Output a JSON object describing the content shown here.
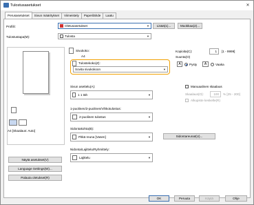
{
  "window": {
    "title": "Tulostusasetukset",
    "close_glyph": "✕"
  },
  "tabs": [
    "Perusasetukset",
    "Sivun määritykset",
    "Viimeistely",
    "Paperilähde",
    "Laatu"
  ],
  "profile": {
    "label": "Profiili:",
    "value": "Oletusasetukset",
    "add": "Lisää(1)...",
    "edit": "Muokkaa(2)..."
  },
  "output": {
    "label": "Tulostustapa(M):",
    "value": "Tulosta"
  },
  "page_size": {
    "label": "Sivukoko:",
    "value": "A4"
  },
  "output_size": {
    "label": "Tulostekoko(Z):",
    "value": "Sovita sivukokoon"
  },
  "copies": {
    "label": "Kopioita(C):",
    "value": "1",
    "range": "[1 - 9999]"
  },
  "orientation": {
    "label": "Suunta(O)",
    "portrait": "Pysty",
    "landscape": "Vaaka"
  },
  "layout": {
    "label": "Sivun asettelu(A):",
    "value": "1 1 täh"
  },
  "manual_scale": {
    "label": "Manuaalinen skaalaus",
    "scale_label": "Skaalaus(O):",
    "scale_value": "100",
    "scale_range": "% [25 - 200]",
    "center": "Alkupiste keskelle(R)"
  },
  "duplex": {
    "label": "1-puolinen/2-puolinen/Vihkotulostus:",
    "value": "2-puolinen tulostus"
  },
  "binding": {
    "label": "Sidontakohta(B):",
    "value": "Pitkä reuna [Vasen]",
    "margin_btn": "Sidontareunat(U)..."
  },
  "collate": {
    "label": "Nidonta/Lajittelu/Ryhmittely:",
    "value": "Lajittelu"
  },
  "preview": {
    "caption": "A4 [Skaalaus: Auto]"
  },
  "left_buttons": [
    "Näytä asetukset(V)",
    "Language Settings(W)...",
    "Palauta oletukset(R)"
  ],
  "footer": [
    "OK",
    "Peruuta",
    "Käytä",
    "Ohje"
  ]
}
